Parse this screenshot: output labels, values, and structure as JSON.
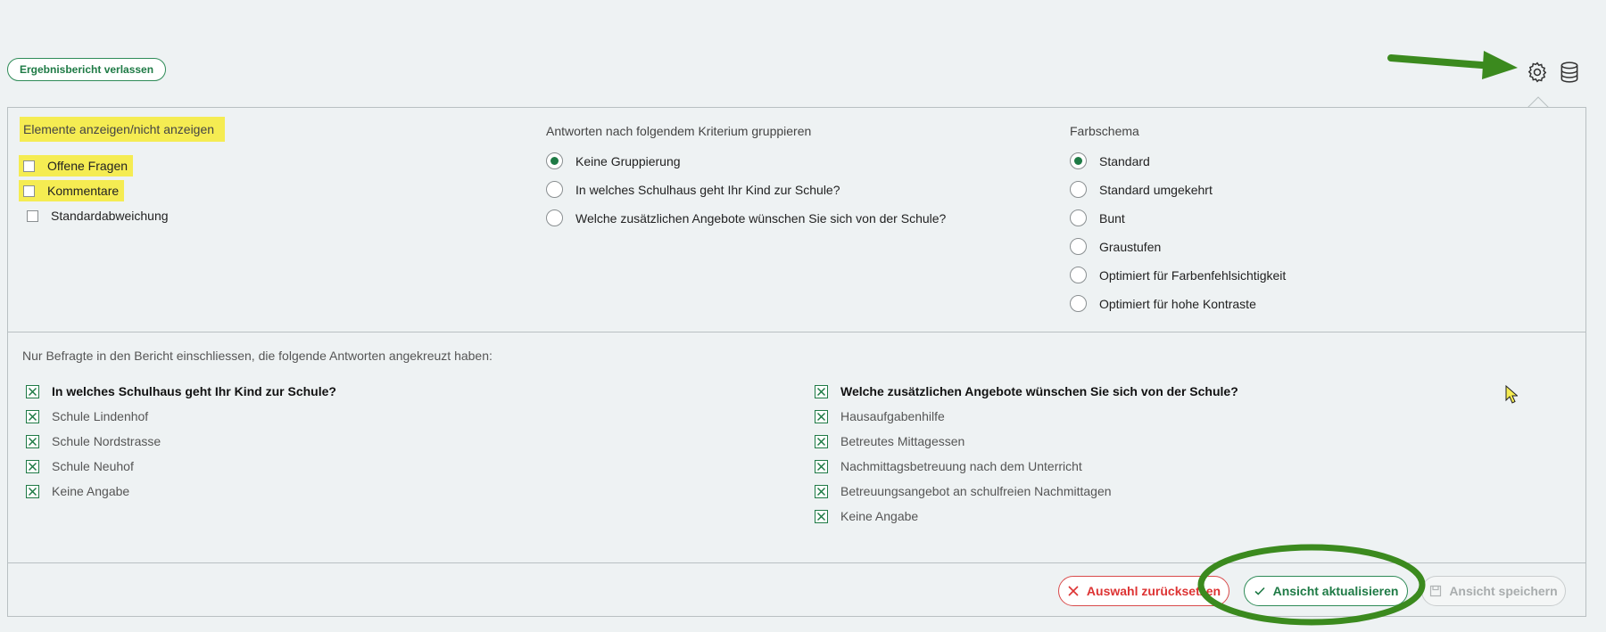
{
  "header": {
    "exit_label": "Ergebnisbericht verlassen",
    "icons": [
      "gear-icon",
      "database-icon"
    ]
  },
  "elements": {
    "title": "Elemente anzeigen/nicht anzeigen",
    "items": [
      {
        "label": "Offene Fragen",
        "checked": false
      },
      {
        "label": "Kommentare",
        "checked": false
      },
      {
        "label": "Standardabweichung",
        "checked": false
      }
    ]
  },
  "grouping": {
    "title": "Antworten nach folgendem Kriterium gruppieren",
    "options": [
      {
        "label": "Keine Gruppierung",
        "selected": true
      },
      {
        "label": "In welches Schulhaus geht Ihr Kind zur Schule?",
        "selected": false
      },
      {
        "label": "Welche zusätzlichen Angebote wünschen Sie sich von der Schule?",
        "selected": false
      }
    ]
  },
  "colorscheme": {
    "title": "Farbschema",
    "options": [
      {
        "label": "Standard",
        "selected": true
      },
      {
        "label": "Standard umgekehrt",
        "selected": false
      },
      {
        "label": "Bunt",
        "selected": false
      },
      {
        "label": "Graustufen",
        "selected": false
      },
      {
        "label": "Optimiert für Farbenfehlsichtigkeit",
        "selected": false
      },
      {
        "label": "Optimiert für hohe Kontraste",
        "selected": false
      }
    ]
  },
  "filter": {
    "title": "Nur Befragte in den Bericht einschliessen, die folgende Antworten angekreuzt haben:",
    "q1": {
      "question": "In welches Schulhaus geht Ihr Kind zur Schule?",
      "answers": [
        "Schule Lindenhof",
        "Schule Nordstrasse",
        "Schule Neuhof",
        "Keine Angabe"
      ]
    },
    "q2": {
      "question": "Welche zusätzlichen Angebote wünschen Sie sich von der Schule?",
      "answers": [
        "Hausaufgabenhilfe",
        "Betreutes Mittagessen",
        "Nachmittagsbetreuung nach dem Unterricht",
        "Betreuungsangebot an schulfreien Nachmittagen",
        "Keine Angabe"
      ]
    }
  },
  "actions": {
    "reset_label": "Auswahl zurücksetzen",
    "update_label": "Ansicht aktualisieren",
    "save_label": "Ansicht speichern"
  },
  "colors": {
    "accent": "#1e7a45",
    "danger": "#d33333",
    "highlight": "#f5ec52",
    "annotation_green": "#3b8a1e"
  }
}
